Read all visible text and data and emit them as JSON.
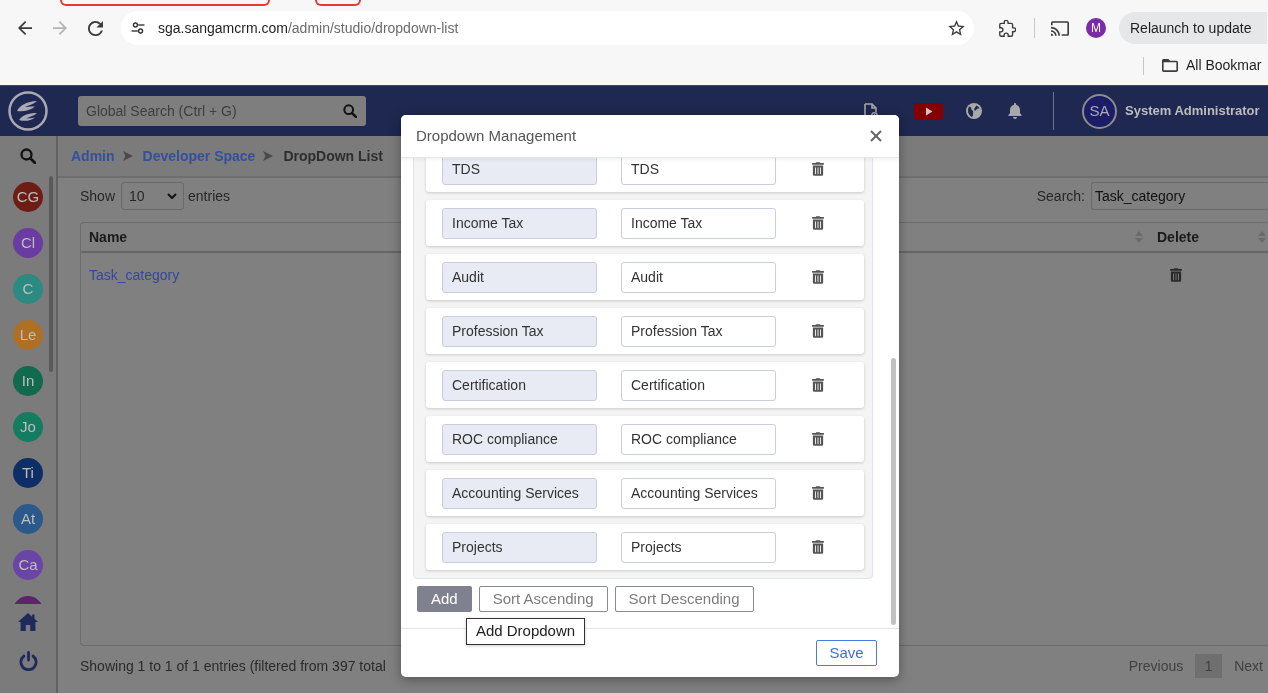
{
  "browser": {
    "nav": [
      {
        "kind": "back",
        "disabled": false
      },
      {
        "kind": "forward",
        "disabled": true
      },
      {
        "kind": "reload",
        "disabled": false
      }
    ],
    "url_host": "sga.sangamcrm.com",
    "url_path": "/admin/studio/dropdown-list",
    "profile_initial": "M",
    "relaunch_button": "Relaunch to update",
    "bookmarks_folder": "All Bookmar"
  },
  "header": {
    "search_placeholder": "Global Search (Ctrl + G)",
    "user_initials": "SA",
    "user_name": "System Administrator"
  },
  "sidebar": {
    "items": [
      {
        "initials": "CG",
        "color": "#6e1d14"
      },
      {
        "initials": "Cl",
        "color": "#6a3ca2"
      },
      {
        "initials": "C",
        "color": "#2b8a82"
      },
      {
        "initials": "Le",
        "color": "#ad7024"
      },
      {
        "initials": "In",
        "color": "#11694e"
      },
      {
        "initials": "Jo",
        "color": "#147c60"
      },
      {
        "initials": "Ti",
        "color": "#0d2e66"
      },
      {
        "initials": "At",
        "color": "#2b598b"
      },
      {
        "initials": "Ca",
        "color": "#6a45a6"
      },
      {
        "color": "#5b2468"
      }
    ]
  },
  "breadcrumb": [
    {
      "label": "Admin",
      "current": false
    },
    {
      "label": "Developer Space",
      "current": false
    },
    {
      "label": "DropDown List",
      "current": true
    }
  ],
  "list_controls": {
    "show_label": "Show",
    "page_size": "10",
    "entries_label": "entries",
    "search_label": "Search:",
    "search_value": "Task_category"
  },
  "table": {
    "columns": [
      {
        "label": "Name"
      },
      {
        "label": "Delete"
      }
    ],
    "rows": [
      {
        "name": "Task_category"
      }
    ]
  },
  "table_footer": {
    "info": "Showing 1 to 1 of 1 entries (filtered from 397 total",
    "previous": "Previous",
    "pages": [
      {
        "label": "1",
        "selected": true
      }
    ],
    "next": "Next"
  },
  "modal": {
    "title": "Dropdown Management",
    "options": [
      {
        "readonly_text": "TDS",
        "editable_text": "TDS"
      },
      {
        "readonly_text": "Income Tax",
        "editable_text": "Income Tax"
      },
      {
        "readonly_text": "Audit",
        "editable_text": "Audit"
      },
      {
        "readonly_text": "Profession Tax",
        "editable_text": "Profession Tax"
      },
      {
        "readonly_text": "Certification",
        "editable_text": "Certification"
      },
      {
        "readonly_text": "ROC compliance",
        "editable_text": "ROC compliance"
      },
      {
        "readonly_text": "Accounting Services",
        "editable_text": "Accounting Services"
      },
      {
        "readonly_text": "Projects",
        "editable_text": "Projects"
      }
    ],
    "buttons": [
      {
        "label": "Add",
        "kind": "filled"
      },
      {
        "label": "Sort Ascending",
        "kind": "outline"
      },
      {
        "label": "Sort Descending",
        "kind": "outline"
      }
    ],
    "tooltip": "Add Dropdown",
    "save_button": "Save"
  }
}
